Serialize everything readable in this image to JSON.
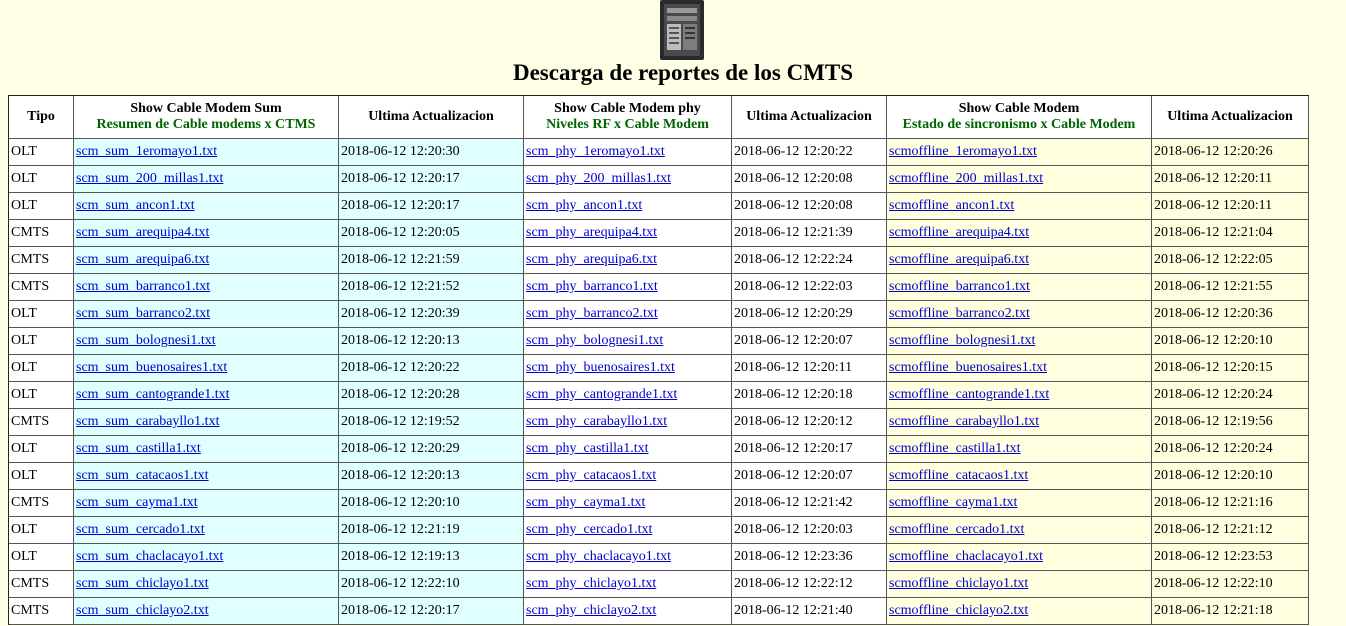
{
  "page": {
    "title": "Descarga de reportes de los CMTS",
    "logo_icon": "server-rack-icon"
  },
  "headers": {
    "tipo": "Tipo",
    "sum": {
      "label": "Show Cable Modem Sum",
      "sub": "Resumen de Cable modems x CTMS"
    },
    "act1": "Ultima Actualizacion",
    "phy": {
      "label": "Show Cable Modem phy",
      "sub": "Niveles RF x Cable Modem"
    },
    "act2": "Ultima Actualizacion",
    "off": {
      "label": "Show Cable Modem",
      "sub": "Estado de sincronismo x Cable Modem"
    },
    "act3": "Ultima Actualizacion"
  },
  "colors": {
    "cyan_column": "#e0ffff",
    "yellow_column": "#ffffe0",
    "subtitle_green": "#006400",
    "link_blue": "#0000cc",
    "page_background": "#ffffe6"
  },
  "rows": [
    {
      "tipo": "OLT",
      "sum": "scm_sum_1eromayo1.txt",
      "t1": "2018-06-12 12:20:30",
      "phy": "scm_phy_1eromayo1.txt",
      "t2": "2018-06-12 12:20:22",
      "off": "scmoffline_1eromayo1.txt",
      "t3": "2018-06-12 12:20:26"
    },
    {
      "tipo": "OLT",
      "sum": "scm_sum_200_millas1.txt",
      "t1": "2018-06-12 12:20:17",
      "phy": "scm_phy_200_millas1.txt",
      "t2": "2018-06-12 12:20:08",
      "off": "scmoffline_200_millas1.txt",
      "t3": "2018-06-12 12:20:11"
    },
    {
      "tipo": "OLT",
      "sum": "scm_sum_ancon1.txt",
      "t1": "2018-06-12 12:20:17",
      "phy": "scm_phy_ancon1.txt",
      "t2": "2018-06-12 12:20:08",
      "off": "scmoffline_ancon1.txt",
      "t3": "2018-06-12 12:20:11"
    },
    {
      "tipo": "CMTS",
      "sum": "scm_sum_arequipa4.txt",
      "t1": "2018-06-12 12:20:05",
      "phy": "scm_phy_arequipa4.txt",
      "t2": "2018-06-12 12:21:39",
      "off": "scmoffline_arequipa4.txt",
      "t3": "2018-06-12 12:21:04"
    },
    {
      "tipo": "CMTS",
      "sum": "scm_sum_arequipa6.txt",
      "t1": "2018-06-12 12:21:59",
      "phy": "scm_phy_arequipa6.txt",
      "t2": "2018-06-12 12:22:24",
      "off": "scmoffline_arequipa6.txt",
      "t3": "2018-06-12 12:22:05"
    },
    {
      "tipo": "CMTS",
      "sum": "scm_sum_barranco1.txt",
      "t1": "2018-06-12 12:21:52",
      "phy": "scm_phy_barranco1.txt",
      "t2": "2018-06-12 12:22:03",
      "off": "scmoffline_barranco1.txt",
      "t3": "2018-06-12 12:21:55"
    },
    {
      "tipo": "OLT",
      "sum": "scm_sum_barranco2.txt",
      "t1": "2018-06-12 12:20:39",
      "phy": "scm_phy_barranco2.txt",
      "t2": "2018-06-12 12:20:29",
      "off": "scmoffline_barranco2.txt",
      "t3": "2018-06-12 12:20:36"
    },
    {
      "tipo": "OLT",
      "sum": "scm_sum_bolognesi1.txt",
      "t1": "2018-06-12 12:20:13",
      "phy": "scm_phy_bolognesi1.txt",
      "t2": "2018-06-12 12:20:07",
      "off": "scmoffline_bolognesi1.txt",
      "t3": "2018-06-12 12:20:10"
    },
    {
      "tipo": "OLT",
      "sum": "scm_sum_buenosaires1.txt",
      "t1": "2018-06-12 12:20:22",
      "phy": "scm_phy_buenosaires1.txt",
      "t2": "2018-06-12 12:20:11",
      "off": "scmoffline_buenosaires1.txt",
      "t3": "2018-06-12 12:20:15"
    },
    {
      "tipo": "OLT",
      "sum": "scm_sum_cantogrande1.txt",
      "t1": "2018-06-12 12:20:28",
      "phy": "scm_phy_cantogrande1.txt",
      "t2": "2018-06-12 12:20:18",
      "off": "scmoffline_cantogrande1.txt",
      "t3": "2018-06-12 12:20:24"
    },
    {
      "tipo": "CMTS",
      "sum": "scm_sum_carabayllo1.txt",
      "t1": "2018-06-12 12:19:52",
      "phy": "scm_phy_carabayllo1.txt",
      "t2": "2018-06-12 12:20:12",
      "off": "scmoffline_carabayllo1.txt",
      "t3": "2018-06-12 12:19:56"
    },
    {
      "tipo": "OLT",
      "sum": "scm_sum_castilla1.txt",
      "t1": "2018-06-12 12:20:29",
      "phy": "scm_phy_castilla1.txt",
      "t2": "2018-06-12 12:20:17",
      "off": "scmoffline_castilla1.txt",
      "t3": "2018-06-12 12:20:24"
    },
    {
      "tipo": "OLT",
      "sum": "scm_sum_catacaos1.txt",
      "t1": "2018-06-12 12:20:13",
      "phy": "scm_phy_catacaos1.txt",
      "t2": "2018-06-12 12:20:07",
      "off": "scmoffline_catacaos1.txt",
      "t3": "2018-06-12 12:20:10"
    },
    {
      "tipo": "CMTS",
      "sum": "scm_sum_cayma1.txt",
      "t1": "2018-06-12 12:20:10",
      "phy": "scm_phy_cayma1.txt",
      "t2": "2018-06-12 12:21:42",
      "off": "scmoffline_cayma1.txt",
      "t3": "2018-06-12 12:21:16"
    },
    {
      "tipo": "OLT",
      "sum": "scm_sum_cercado1.txt",
      "t1": "2018-06-12 12:21:19",
      "phy": "scm_phy_cercado1.txt",
      "t2": "2018-06-12 12:20:03",
      "off": "scmoffline_cercado1.txt",
      "t3": "2018-06-12 12:21:12"
    },
    {
      "tipo": "OLT",
      "sum": "scm_sum_chaclacayo1.txt",
      "t1": "2018-06-12 12:19:13",
      "phy": "scm_phy_chaclacayo1.txt",
      "t2": "2018-06-12 12:23:36",
      "off": "scmoffline_chaclacayo1.txt",
      "t3": "2018-06-12 12:23:53"
    },
    {
      "tipo": "CMTS",
      "sum": "scm_sum_chiclayo1.txt",
      "t1": "2018-06-12 12:22:10",
      "phy": "scm_phy_chiclayo1.txt",
      "t2": "2018-06-12 12:22:12",
      "off": "scmoffline_chiclayo1.txt",
      "t3": "2018-06-12 12:22:10"
    },
    {
      "tipo": "CMTS",
      "sum": "scm_sum_chiclayo2.txt",
      "t1": "2018-06-12 12:20:17",
      "phy": "scm_phy_chiclayo2.txt",
      "t2": "2018-06-12 12:21:40",
      "off": "scmoffline_chiclayo2.txt",
      "t3": "2018-06-12 12:21:18"
    }
  ]
}
